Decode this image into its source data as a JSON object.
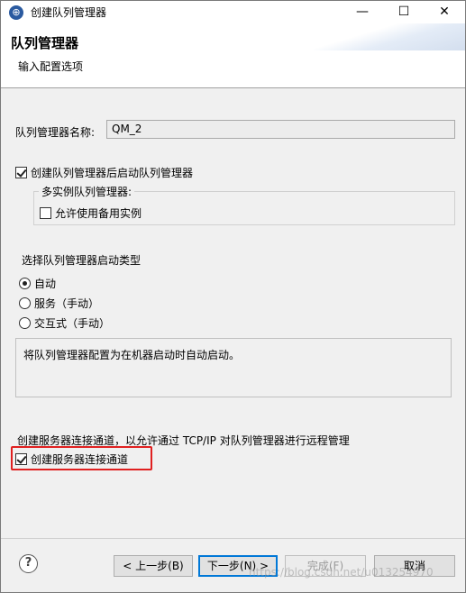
{
  "window": {
    "title": "创建队列管理器",
    "minimize_glyph": "—",
    "maximize_glyph": "☐",
    "close_glyph": "✕"
  },
  "banner": {
    "title": "队列管理器",
    "description": "输入配置选项"
  },
  "form": {
    "qm_name_label": "队列管理器名称:",
    "qm_name_value": "QM_2",
    "start_after_create": {
      "label": "创建队列管理器后启动队列管理器",
      "checked": true
    },
    "multi_instance_group": {
      "legend": "多实例队列管理器:",
      "allow_standby": {
        "label": "允许使用备用实例",
        "checked": false
      }
    },
    "startup_type_label": "选择队列管理器启动类型",
    "startup_options": [
      {
        "label": "自动",
        "selected": true
      },
      {
        "label": "服务（手动）",
        "selected": false
      },
      {
        "label": "交互式（手动）",
        "selected": false
      }
    ],
    "startup_description": "将队列管理器配置为在机器启动时自动启动。",
    "channel_description": "创建服务器连接通道，以允许通过 TCP/IP 对队列管理器进行远程管理",
    "create_channel": {
      "label": "创建服务器连接通道",
      "checked": true
    }
  },
  "footer": {
    "help_glyph": "?",
    "back_label": "< 上一步(B)",
    "next_label": "下一步(N) >",
    "finish_label": "完成(F)",
    "cancel_label": "取消"
  },
  "watermark": "https://blog.csdn.net/u013254970",
  "colors": {
    "highlight": "#e02020",
    "primary_border": "#0078d7"
  },
  "icons": {
    "app": "settings-globe-icon",
    "help": "help-icon"
  }
}
